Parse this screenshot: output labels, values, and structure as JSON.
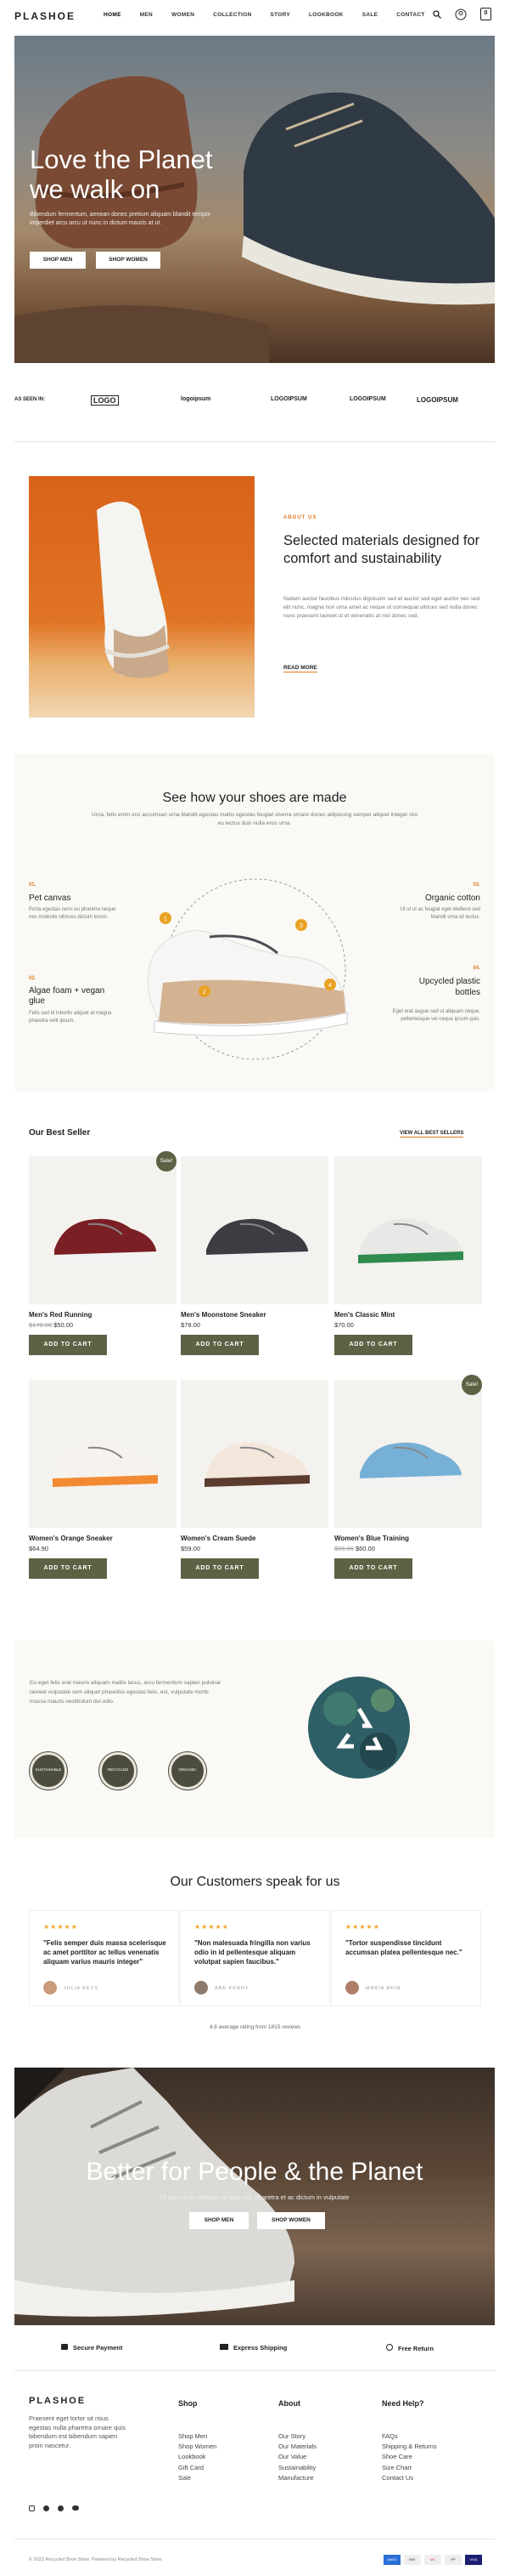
{
  "header": {
    "logo": "PLASHOE",
    "menu": [
      "HOME",
      "MEN",
      "WOMEN",
      "COLLECTION",
      "STORY",
      "LOOKBOOK",
      "SALE",
      "CONTACT"
    ],
    "cart_count": "0"
  },
  "hero": {
    "title_line1": "Love the Planet",
    "title_line2": "we walk on",
    "text": "Bibendum fermentum, aenean donec pretium aliquam blandit tempor imperdiet arcu arcu ut nunc in dictum mauris at ut.",
    "btn_men": "SHOP MEN",
    "btn_women": "SHOP WOMEN"
  },
  "brands": {
    "label": "AS SEEN IN:",
    "items": [
      "LOGO",
      "logoipsum",
      "LOGOIPSUM",
      "LOGOIPSUM",
      "LOGOIPSUM"
    ]
  },
  "about": {
    "kicker": "ABOUT US",
    "title": "Selected materials designed for comfort and sustainability",
    "text": "Nullam auctor faucibus ridiculus dignissim sed et auctor sed eget auctor nec sed elit nunc, magna non urna amet ac neque ut consequat ultrices sed nulla donec nunc praesent laoreet ut et venenatis at nisl donec sed.",
    "link": "READ MORE"
  },
  "features": {
    "title": "See how your shoes are made",
    "subtitle": "Urna, felis enim orci accumsan urna blandit egestas mattis egestas feugiat viverra ornare donec adipiscing semper aliquet integer nisi eu lectus duis nulla eros urna.",
    "items": [
      {
        "num": "01.",
        "title": "Pet canvas",
        "text": "Porta egestas nunc eu pharetra neque nec molestie ultricies dictum lorem."
      },
      {
        "num": "02.",
        "title": "Algae foam + vegan glue",
        "text": "Felis sed id lobortis aliquet at magna pharetra velit ipsum."
      },
      {
        "num": "03.",
        "title": "Organic cotton",
        "text": "Ut ut ut ac feugiat eget eleifend sed blandit urna sit lectus."
      },
      {
        "num": "04.",
        "title": "Upcycled plastic bottles",
        "text": "Eget erat augue sed ut aliquam neque, pellentesque vel neque ipsum quis."
      }
    ],
    "markers": [
      "1",
      "2",
      "3",
      "4"
    ]
  },
  "bestsellers": {
    "title": "Our Best Seller",
    "link": "VIEW ALL BEST SELLERS",
    "add_label": "ADD TO CART",
    "products": [
      {
        "name": "Men's Red Running",
        "old": "$170.00",
        "price": "$50.00",
        "badge": "Sale!"
      },
      {
        "name": "Men's Moonstone Sneaker",
        "old": "",
        "price": "$78.00",
        "badge": ""
      },
      {
        "name": "Men's Classic Mint",
        "old": "",
        "price": "$70.00",
        "badge": ""
      },
      {
        "name": "Women's Orange Sneaker",
        "old": "",
        "price": "$64.90",
        "badge": ""
      },
      {
        "name": "Women's Cream Suede",
        "old": "",
        "price": "$59.00",
        "badge": ""
      },
      {
        "name": "Women's Blue Training",
        "old": "$66.00",
        "price": "$60.00",
        "badge": "Sale!"
      }
    ]
  },
  "eco": {
    "text": "Eu eget felis erat mauris aliquam mattis lacus, arcu fermentum sapien pulvinar laoreet vulputate sem aliquet phasellus egestas felis, est, vulputate morbi massa mauris vestibulum dui odio.",
    "badges": [
      "SUSTAINABLE",
      "RECYCLED",
      "ORGANIC"
    ]
  },
  "testimonials": {
    "title": "Our Customers speak for us",
    "stars": "★★★★★",
    "items": [
      {
        "text": "\"Felis semper duis massa scelerisque ac amet porttitor ac tellus venenatis aliquam varius mauris integer\"",
        "name": "JULIA KEYS"
      },
      {
        "text": "\"Non malesuada fringilla non varius odio in id pellentesque aliquam volutpat sapien faucibus.\"",
        "name": "ABE KENNY"
      },
      {
        "text": "\"Tortor suspendisse tincidunt accumsan platea pellentesque nec.\"",
        "name": "MARIA AKIN"
      }
    ],
    "rating": "4.8 average rating from 1815 reviews"
  },
  "banner": {
    "title": "Better for People & the Planet",
    "text": "Ut eget at et aliquam sit quis nisi, pharetra et ac dictum in vulputate",
    "btn_men": "SHOP MEN",
    "btn_women": "SHOP WOMEN"
  },
  "perks": [
    "Secure Payment",
    "Express Shipping",
    "Free Return"
  ],
  "footer": {
    "logo": "PLASHOE",
    "text": "Praesent eget tortor sit risus egestas nulla pharetra ornare quis bibendum est bibendum sapien proin nascetur.",
    "cols": [
      {
        "title": "Shop",
        "links": [
          "Shop Men",
          "Shop Women",
          "Lookbook",
          "Gift Card",
          "Sale"
        ]
      },
      {
        "title": "About",
        "links": [
          "Our Story",
          "Our Materials",
          "Our Value",
          "Sustainability",
          "Manufacture"
        ]
      },
      {
        "title": "Need Help?",
        "links": [
          "FAQs",
          "Shipping & Returns",
          "Shoe Care",
          "Size Chart",
          "Contact Us"
        ]
      }
    ],
    "copyright": "© 2023 Recycled Shoe Store. Powered by Recycled Shoe Store.",
    "payments": [
      "AMEX",
      "PAY",
      "MC",
      "PP",
      "VISA"
    ]
  }
}
